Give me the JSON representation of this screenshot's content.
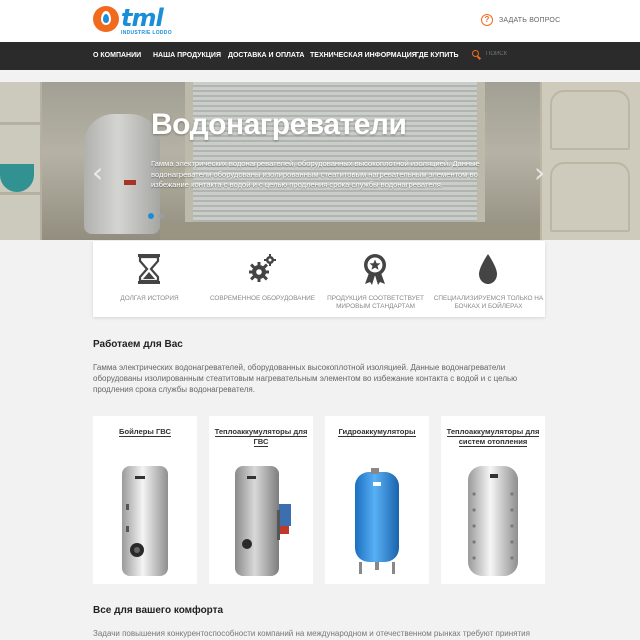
{
  "header": {
    "logo_word": "tml",
    "logo_sub": "INDUSTRIE LODDO",
    "ask_label": "ЗАДАТЬ ВОПРОС"
  },
  "nav": {
    "items": [
      {
        "label": "О КОМПАНИИ"
      },
      {
        "label": "НАША ПРОДУКЦИЯ"
      },
      {
        "label": "ДОСТАВКА И ОПЛАТА"
      },
      {
        "label": "ТЕХНИЧЕСКАЯ ИНФОРМАЦИЯ"
      },
      {
        "label": "ГДЕ КУПИТЬ"
      }
    ],
    "search_placeholder": "ПОИСК"
  },
  "hero": {
    "title": "Водонагреватели",
    "text": "Гамма электрических водонагревателей, оборудованных высокоплотной изоляцией. Данные водонагреватели оборудованы изолированным стеатитовым нагревательным элементом во избежание контакта с водой и с целью продления срока службы водонагревателя.",
    "prev_arrow": "‹",
    "next_arrow": "›",
    "active_slide": 1,
    "slide_count": 2
  },
  "features": [
    {
      "label": "ДОЛГАЯ ИСТОРИЯ",
      "icon": "hourglass-icon"
    },
    {
      "label": "СОВРЕМЕННОЕ ОБОРУДОВАНИЕ",
      "icon": "gears-icon"
    },
    {
      "label": "ПРОДУКЦИЯ СООТВЕТСТВУЕТ МИРОВЫМ СТАНДАРТАМ",
      "icon": "award-icon"
    },
    {
      "label": "СПЕЦИАЛИЗИРУЕМСЯ ТОЛЬКО НА БОЧКАХ И БОЙЛЕРАХ",
      "icon": "drop-icon"
    }
  ],
  "about": {
    "title": "Работаем для Вас",
    "text": "Гамма электрических водонагревателей, оборудованных высокоплотной изоляцией. Данные водонагреватели оборудованы изолированным стеатитовым нагревательным элементом во избежание контакта с водой и с целью продления срока службы водонагревателя."
  },
  "products": [
    {
      "title": "Бойлеры ГВС",
      "color": "#d8d8d8"
    },
    {
      "title": "Теплоаккумуляторы для ГВС",
      "color": "#c4c4c4"
    },
    {
      "title": "Гидроаккумуляторы",
      "color": "#2f8fe0"
    },
    {
      "title": "Теплоаккумуляторы для систем отопления",
      "color": "#e6e6e6"
    }
  ],
  "comfort": {
    "title": "Все для вашего комфорта",
    "text": "Задачи повышения конкурентоспособности компаний на международном и отечественном рынках требуют принятия"
  },
  "colors": {
    "accent_orange": "#f26b1d",
    "brand_blue": "#1a8fd8",
    "nav_bg": "#2b2b2b",
    "dot_active": "#1a8fd8",
    "dot_inactive": "#9c9c9c"
  }
}
